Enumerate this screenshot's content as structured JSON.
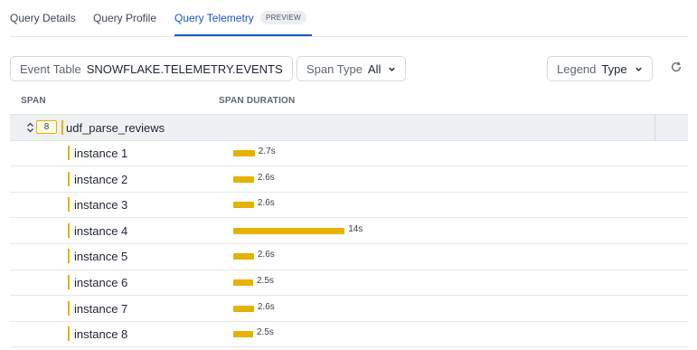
{
  "tabs": [
    {
      "label": "Query Details",
      "active": false
    },
    {
      "label": "Query Profile",
      "active": false
    },
    {
      "label": "Query Telemetry",
      "active": true,
      "badge": "PREVIEW"
    }
  ],
  "toolbar": {
    "event_table": {
      "label": "Event Table",
      "value": "SNOWFLAKE.TELEMETRY.EVENTS"
    },
    "span_type": {
      "label": "Span Type",
      "value": "All"
    },
    "legend": {
      "label": "Legend",
      "value": "Type"
    },
    "refresh_icon": "refresh-icon"
  },
  "columns": {
    "span": "SPAN",
    "duration": "SPAN DURATION"
  },
  "group": {
    "count": "8",
    "name": "udf_parse_reviews",
    "expanded": true
  },
  "rows": [
    {
      "name": "instance 1",
      "duration": "2.7s",
      "seconds": 2.7
    },
    {
      "name": "instance 2",
      "duration": "2.6s",
      "seconds": 2.6
    },
    {
      "name": "instance 3",
      "duration": "2.6s",
      "seconds": 2.6
    },
    {
      "name": "instance 4",
      "duration": "14s",
      "seconds": 14
    },
    {
      "name": "instance 5",
      "duration": "2.6s",
      "seconds": 2.6
    },
    {
      "name": "instance 6",
      "duration": "2.5s",
      "seconds": 2.5
    },
    {
      "name": "instance 7",
      "duration": "2.6s",
      "seconds": 2.6
    },
    {
      "name": "instance 8",
      "duration": "2.5s",
      "seconds": 2.5
    }
  ],
  "colors": {
    "accent": "#1a56c6",
    "span_bar": "#e5b200"
  }
}
